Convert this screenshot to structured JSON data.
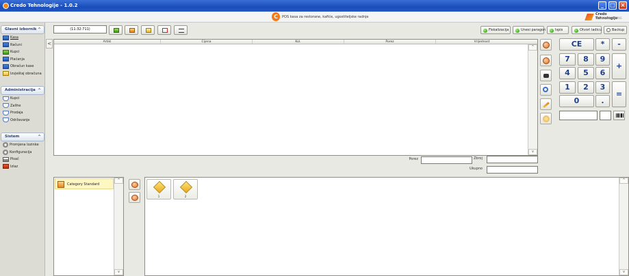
{
  "window": {
    "title": "Credo Tehnologije - 1.0.2"
  },
  "banner": {
    "tagline": "POS kasa za restorane, kafiće, ugostiteljske radnje",
    "brand_name": "Credo Tehnologije",
    "brand_sub": "CREDO SOLUTIONS"
  },
  "sidebar": {
    "sections": [
      {
        "title": "Glavni izbornik",
        "items": [
          "Kasa",
          "Računi",
          "Kupci",
          "Plaćanja",
          "Obračun kase",
          "Izvještaj obračuna"
        ]
      },
      {
        "title": "Administracija",
        "items": [
          "Kupci",
          "Zalihe",
          "Prodaja",
          "Održavanje"
        ]
      },
      {
        "title": "Sistem",
        "items": [
          "Promjena lozinke",
          "Konfiguracija",
          "Pisač",
          "Izlaz"
        ]
      }
    ]
  },
  "toolbar": {
    "time": "(11:32:711)",
    "right_buttons": [
      "Fiskalizacija",
      "Unesi paragon",
      "Ispis",
      "Otvori ladicu",
      "Backup"
    ]
  },
  "grid": {
    "columns": [
      "Artikl",
      "Cijena",
      "Kol.",
      "Porez",
      "Vrijednost"
    ]
  },
  "keypad": {
    "keys": [
      "CE",
      "*",
      "-",
      "7",
      "8",
      "9",
      "+",
      "4",
      "5",
      "6",
      "1",
      "2",
      "3",
      "=",
      "0",
      "."
    ]
  },
  "totals": {
    "porez_label": "Porez",
    "zbroj_label": "Zbroj",
    "ukupno_label": "Ukupno"
  },
  "categories": [
    {
      "name": "Category Standard"
    }
  ],
  "products": [
    {
      "label": "1"
    },
    {
      "label": "2"
    }
  ],
  "scroll": {
    "up": "^",
    "down": "v",
    "collapse": "<"
  }
}
